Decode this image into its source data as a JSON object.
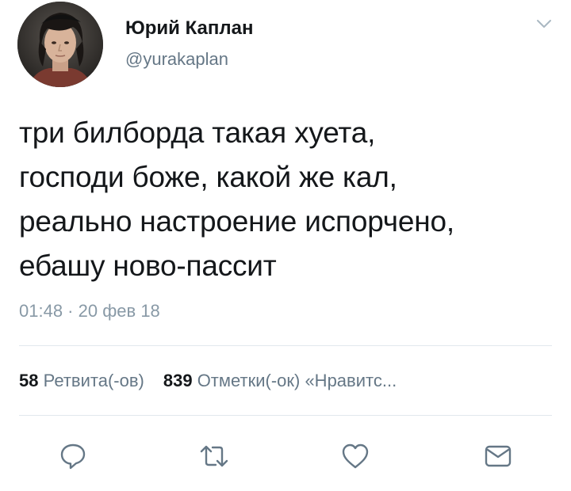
{
  "author": {
    "name": "Юрий Каплан",
    "handle": "@yurakaplan",
    "avatar": "avatar-photo"
  },
  "menu_icon": "chevron-down-icon",
  "tweet": {
    "lines": [
      "три билборда такая хуета,",
      "господи боже, какой же кал,",
      "реально настроение испорчено,",
      "ебашу ново-пассит"
    ],
    "timestamp": "01:48 · 20 фев 18"
  },
  "stats": {
    "retweets_count": "58",
    "retweets_label": "Ретвита(-ов)",
    "likes_count": "839",
    "likes_label": "Отметки(-ок) «Нравитс..."
  },
  "actions": [
    {
      "name": "reply",
      "icon": "reply-bubble-icon"
    },
    {
      "name": "retweet",
      "icon": "retweet-icon"
    },
    {
      "name": "like",
      "icon": "heart-icon"
    },
    {
      "name": "message",
      "icon": "envelope-icon"
    }
  ],
  "colors": {
    "text": "#14171a",
    "secondary": "#657786",
    "muted": "#8899a6",
    "divider": "#e1e8ed",
    "icon": "#657786"
  }
}
